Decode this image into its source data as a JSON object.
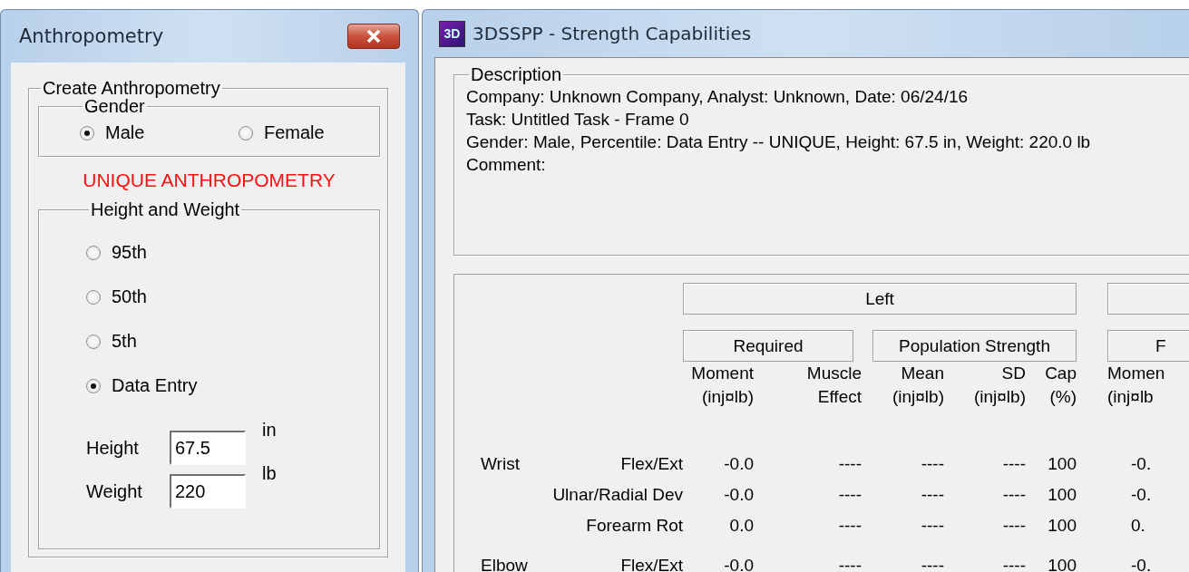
{
  "anthropometry_window": {
    "title": "Anthropometry",
    "group_title": "Create Anthropometry",
    "gender": {
      "title": "Gender",
      "options": [
        {
          "label": "Male",
          "selected": true
        },
        {
          "label": "Female",
          "selected": false
        }
      ]
    },
    "status": "UNIQUE ANTHROPOMETRY",
    "height_weight": {
      "title": "Height and Weight",
      "options": [
        {
          "label": "95th",
          "selected": false
        },
        {
          "label": "50th",
          "selected": false
        },
        {
          "label": "5th",
          "selected": false
        },
        {
          "label": "Data Entry",
          "selected": true
        }
      ],
      "fields": [
        {
          "label": "Height",
          "value": "67.5",
          "unit": "in"
        },
        {
          "label": "Weight",
          "value": "220",
          "unit": "lb"
        }
      ]
    }
  },
  "strength_window": {
    "title": "3DSSPP - Strength Capabilities",
    "app_icon_text": "3D",
    "description": {
      "title": "Description",
      "lines": [
        "Company: Unknown Company, Analyst: Unknown, Date: 06/24/16",
        "Task: Untitled Task - Frame 0",
        "Gender: Male, Percentile: Data Entry -- UNIQUE, Height: 67.5 in, Weight: 220.0 lb",
        "Comment:"
      ]
    },
    "table": {
      "side_header": "Left",
      "sub_headers": [
        "Required",
        "Population Strength"
      ],
      "right_sub_header": "F",
      "columns": [
        {
          "line1": "Moment",
          "line2": "(inj¤lb)"
        },
        {
          "line1": "Muscle",
          "line2": "Effect"
        },
        {
          "line1": "Mean",
          "line2": "(inj¤lb)"
        },
        {
          "line1": "SD",
          "line2": "(inj¤lb)"
        },
        {
          "line1": "Cap",
          "line2": "(%)"
        },
        {
          "line1": "Momen",
          "line2": "(inj¤lb"
        }
      ],
      "rows": [
        {
          "joint": "Wrist",
          "motion": "Flex/Ext",
          "cells": [
            "-0.0",
            "----",
            "----",
            "----",
            "100",
            "-0."
          ]
        },
        {
          "motion": "Ulnar/Radial Dev",
          "cells": [
            "-0.0",
            "----",
            "----",
            "----",
            "100",
            "-0."
          ]
        },
        {
          "motion": "Forearm Rot",
          "cells": [
            "0.0",
            "----",
            "----",
            "----",
            "100",
            "0."
          ]
        },
        {
          "joint": "Elbow",
          "motion": "Flex/Ext",
          "cells": [
            "-0.0",
            "----",
            "----",
            "----",
            "100",
            "-0."
          ]
        }
      ]
    }
  }
}
